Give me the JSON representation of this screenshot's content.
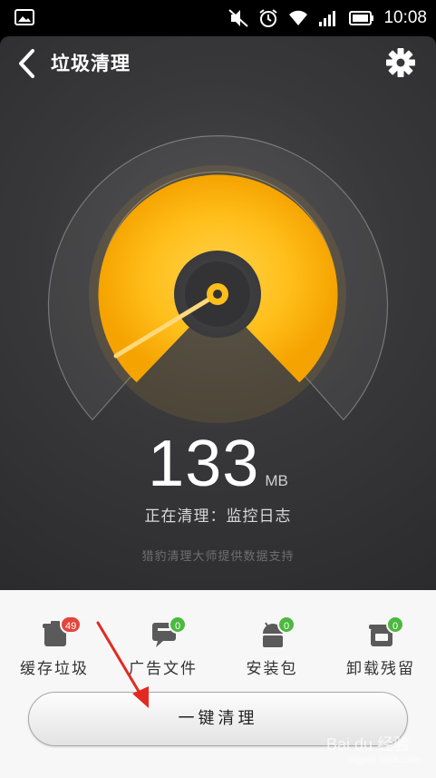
{
  "status_bar": {
    "time": "10:08",
    "icons": [
      "image-icon",
      "mute-icon",
      "alarm-icon",
      "wifi-icon",
      "signal-icon",
      "battery-icon"
    ]
  },
  "header": {
    "title": "垃圾清理",
    "back_icon": "back-arrow-icon",
    "settings_icon": "gear-icon"
  },
  "gauge": {
    "size_value": "133",
    "size_unit": "MB",
    "accent_color": "#ffb400",
    "status_text": "正在清理：监控日志",
    "provider_text": "猎豹清理大师提供数据支持"
  },
  "categories": [
    {
      "label": "缓存垃圾",
      "badge": "49",
      "badge_color": "#e4453c",
      "icon": "cache-trash-icon"
    },
    {
      "label": "广告文件",
      "badge": "0",
      "badge_color": "#4cb83f",
      "icon": "ad-file-icon"
    },
    {
      "label": "安装包",
      "badge": "0",
      "badge_color": "#4cb83f",
      "icon": "android-package-icon"
    },
    {
      "label": "卸载残留",
      "badge": "0",
      "badge_color": "#4cb83f",
      "icon": "uninstall-residue-icon"
    }
  ],
  "actions": {
    "clean_button_label": "一键清理"
  },
  "watermark": {
    "brand": "Bai du 经验",
    "sub": "jingyan.baidu.com"
  }
}
